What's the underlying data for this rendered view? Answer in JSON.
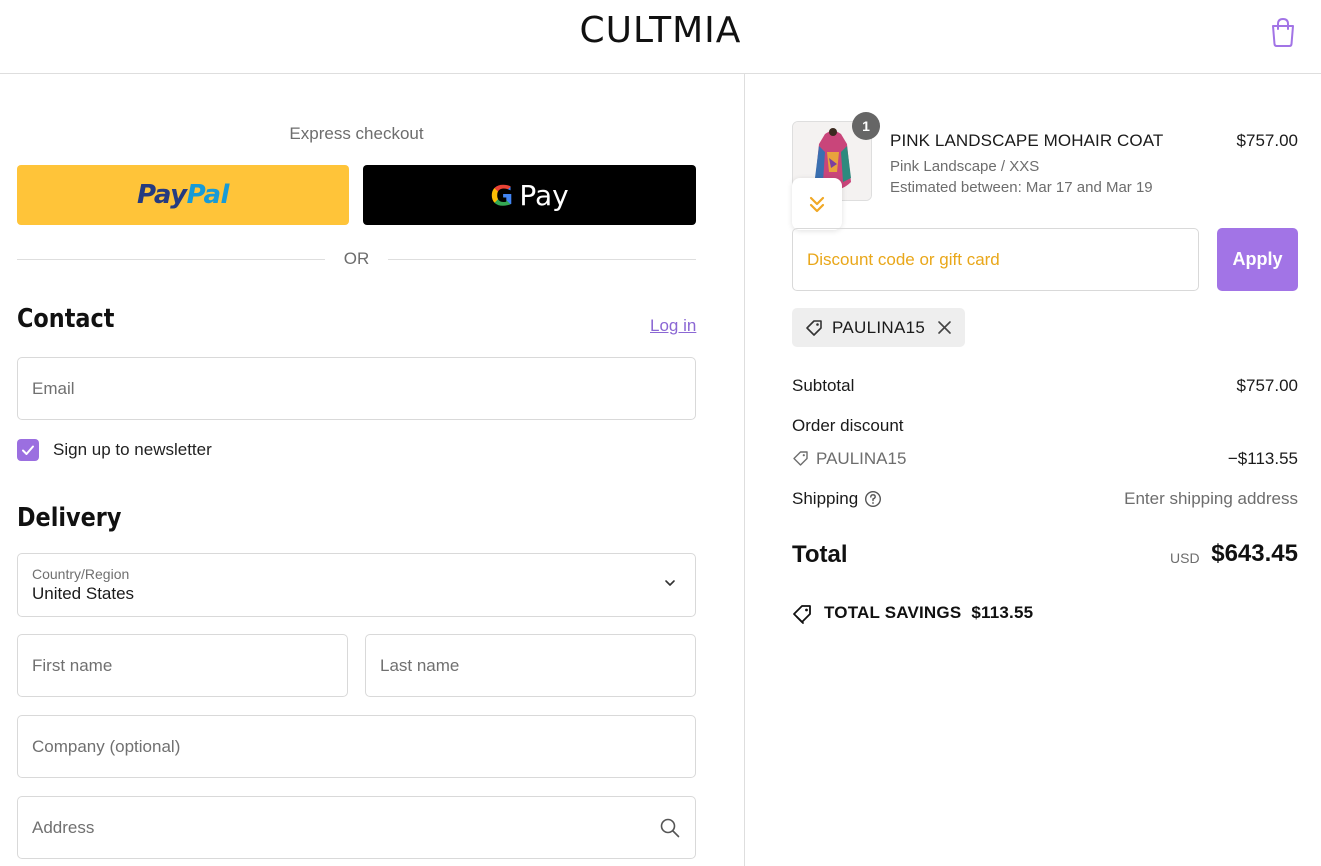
{
  "header": {
    "brand": "CULTMIA",
    "cart_icon": "shopping-bag-icon"
  },
  "express_checkout": {
    "title": "Express checkout",
    "paypal_pay": "Pay",
    "paypal_pal": "Pal",
    "gpay_label": "Pay",
    "gpay_g": "G",
    "divider": "OR"
  },
  "contact": {
    "title": "Contact",
    "login_link": "Log in",
    "email_placeholder": "Email",
    "newsletter_label": "Sign up to newsletter",
    "newsletter_checked": true
  },
  "delivery": {
    "title": "Delivery",
    "country_label": "Country/Region",
    "country_value": "United States",
    "first_name_placeholder": "First name",
    "last_name_placeholder": "Last name",
    "company_placeholder": "Company (optional)",
    "address_placeholder": "Address"
  },
  "order": {
    "quantity": "1",
    "product_name": "PINK LANDSCAPE MOHAIR COAT",
    "variant": "Pink Landscape / XXS",
    "estimate": "Estimated between: Mar 17 and Mar 19",
    "price": "$757.00",
    "discount_placeholder": "Discount code or gift card",
    "apply_label": "Apply",
    "applied_code": "PAULINA15"
  },
  "summary": {
    "subtotal_label": "Subtotal",
    "subtotal_value": "$757.00",
    "discount_label": "Order discount",
    "discount_code": "PAULINA15",
    "discount_value": "−$113.55",
    "shipping_label": "Shipping",
    "shipping_value": "Enter shipping address",
    "total_label": "Total",
    "currency": "USD",
    "total_value": "$643.45",
    "savings_label": "TOTAL SAVINGS",
    "savings_value": "$113.55"
  },
  "colors": {
    "accent": "#a274e6",
    "link": "#8b67d4",
    "placeholder_warning": "#e9a71a",
    "paypal_yellow": "#ffc439"
  }
}
